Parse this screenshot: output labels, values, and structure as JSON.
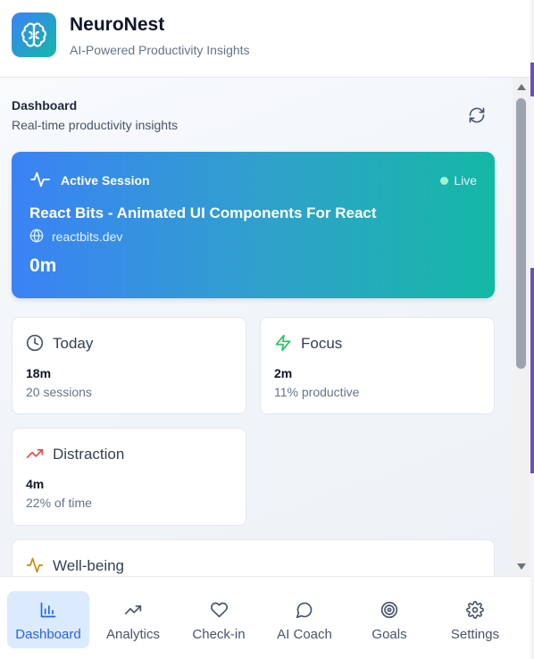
{
  "header": {
    "app_name": "NeuroNest",
    "tagline": "AI-Powered Productivity Insights",
    "logo_icon": "brain-icon"
  },
  "dashboard": {
    "title": "Dashboard",
    "subtitle": "Real-time productivity insights",
    "refresh_icon": "refresh-icon"
  },
  "active_session": {
    "label": "Active Session",
    "status": "Live",
    "page_title": "React Bits - Animated UI Components For React",
    "domain": "reactbits.dev",
    "duration": "0m"
  },
  "stats": {
    "today": {
      "label": "Today",
      "value": "18m",
      "sub": "20 sessions",
      "icon": "clock-icon"
    },
    "focus": {
      "label": "Focus",
      "value": "2m",
      "sub": "11% productive",
      "icon": "lightning-icon"
    },
    "distraction": {
      "label": "Distraction",
      "value": "4m",
      "sub": "22% of time",
      "icon": "trending-up-icon"
    },
    "wellbeing": {
      "label": "Well-being",
      "icon": "activity-icon"
    }
  },
  "nav": {
    "items": [
      {
        "label": "Dashboard",
        "icon": "bar-chart-icon",
        "active": true
      },
      {
        "label": "Analytics",
        "icon": "trending-up-icon",
        "active": false
      },
      {
        "label": "Check-in",
        "icon": "heart-icon",
        "active": false
      },
      {
        "label": "AI Coach",
        "icon": "chat-bubble-icon",
        "active": false
      },
      {
        "label": "Goals",
        "icon": "target-icon",
        "active": false
      },
      {
        "label": "Settings",
        "icon": "gear-icon",
        "active": false
      }
    ]
  },
  "colors": {
    "gradient_start": "#3b82f6",
    "gradient_end": "#14b8a6",
    "active_nav_bg": "#dbeafe",
    "active_nav_text": "#2563eb",
    "focus_green": "#22c55e",
    "distraction_red": "#ef4444",
    "wellbeing_amber": "#ca8a04"
  }
}
